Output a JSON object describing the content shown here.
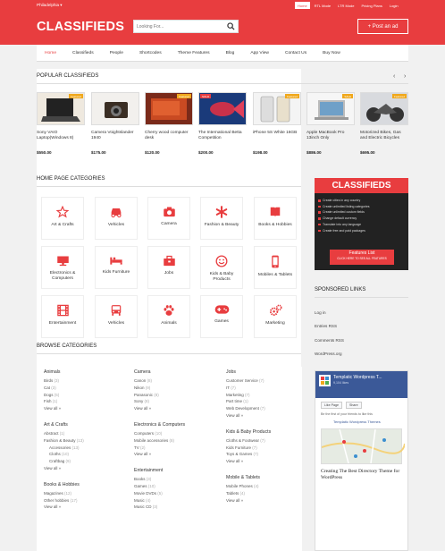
{
  "header": {
    "city": "Philadelphia",
    "top_links": [
      "Home",
      "RTL Mode",
      "LTR Mode",
      "Pricing Plans",
      "Login"
    ],
    "logo": "CLASSIFIEDS",
    "search_placeholder": "Looking For...",
    "post_ad": "+ Post an ad",
    "brand_color": "#e83d3f"
  },
  "nav": [
    "Home",
    "Classifieds",
    "People",
    "Shortcodes",
    "Theme Features",
    "Blog",
    "App View",
    "Contact Us",
    "Buy Now"
  ],
  "popular": {
    "title": "POPULAR CLASSIFIEDS",
    "items": [
      {
        "title": "Sony VAIO Laptop(Windows 8)",
        "price": "$550.00",
        "badge": "Featured"
      },
      {
        "title": "Camera Voightslander 1940",
        "price": "$175.00",
        "badge": ""
      },
      {
        "title": "Cherry wood computer desk",
        "price": "$120.00",
        "badge": "Featured"
      },
      {
        "title": "The International Betta Competition",
        "price": "$200.00",
        "badge": "SOLD"
      },
      {
        "title": "iPhone 5S White 16GB",
        "price": "$198.00",
        "badge": "Featured"
      },
      {
        "title": "Apple MacBook Pro 13inch Only",
        "price": "$886.00",
        "badge": "SALE"
      },
      {
        "title": "Motorized Bikes, Gas and Electric Bicycles",
        "price": "$695.00",
        "badge": "Featured"
      }
    ]
  },
  "home_categories": {
    "title": "HOME PAGE CATEGORIES",
    "items": [
      {
        "label": "Art & Crafts",
        "icon": "star-icon"
      },
      {
        "label": "Vehicles",
        "icon": "car-icon"
      },
      {
        "label": "Camera",
        "icon": "camera-icon"
      },
      {
        "label": "Fashion & Beauty",
        "icon": "asterisk-icon"
      },
      {
        "label": "Books & Hobbies",
        "icon": "book-icon"
      },
      {
        "label": "Electronics & Computers",
        "icon": "monitor-icon"
      },
      {
        "label": "Kids Furniture",
        "icon": "bed-icon"
      },
      {
        "label": "Jobs",
        "icon": "briefcase-icon"
      },
      {
        "label": "Kids & Baby Products",
        "icon": "smile-icon"
      },
      {
        "label": "Mobiles & Tablets",
        "icon": "mobile-icon"
      },
      {
        "label": "Entertainment",
        "icon": "film-icon"
      },
      {
        "label": "Vehicles",
        "icon": "truck-icon"
      },
      {
        "label": "Animals",
        "icon": "paw-icon"
      },
      {
        "label": "Games",
        "icon": "gamepad-icon"
      },
      {
        "label": "Marketing",
        "icon": "gears-icon"
      }
    ]
  },
  "browse": {
    "title": "BROWSE CATEGORIES",
    "columns": [
      [
        {
          "title": "Animals",
          "items": [
            [
              "Birds",
              "(3)",
              false
            ],
            [
              "Cat",
              "(3)",
              false
            ],
            [
              "Dogs",
              "(5)",
              false
            ],
            [
              "Fish",
              "(1)",
              false
            ],
            [
              "View all »",
              "",
              false
            ]
          ]
        },
        {
          "title": "Art & Crafts",
          "items": [
            [
              "Abstract",
              "(1)",
              false
            ],
            [
              "Fashion & Beauty",
              "(13)",
              false
            ],
            [
              "Accessories",
              "(13)",
              true
            ],
            [
              "Cloths",
              "(10)",
              true
            ],
            [
              "Craftbag",
              "(9)",
              true
            ],
            [
              "View all »",
              "",
              false
            ]
          ]
        },
        {
          "title": "Books & Hobbies",
          "items": [
            [
              "Magazines",
              "(12)",
              false
            ],
            [
              "Other hobbies",
              "(17)",
              false
            ],
            [
              "View all »",
              "",
              false
            ]
          ]
        }
      ],
      [
        {
          "title": "Camera",
          "items": [
            [
              "Canon",
              "(8)",
              false
            ],
            [
              "Nikon",
              "(9)",
              false
            ],
            [
              "Panasonic",
              "(8)",
              false
            ],
            [
              "Sony",
              "(8)",
              false
            ],
            [
              "View all »",
              "",
              false
            ]
          ]
        },
        {
          "title": "Electronics & Computers",
          "items": [
            [
              "Computers",
              "(10)",
              false
            ],
            [
              "Mobile accessories",
              "(8)",
              false
            ],
            [
              "TV",
              "(2)",
              false
            ],
            [
              "View all »",
              "",
              false
            ]
          ]
        },
        {
          "title": "Entertainment",
          "items": [
            [
              "Books",
              "(3)",
              false
            ],
            [
              "Games",
              "(10)",
              false
            ],
            [
              "Movie DVDs",
              "(5)",
              false
            ],
            [
              "Music",
              "(4)",
              false
            ],
            [
              "Music CD",
              "(3)",
              false
            ]
          ]
        }
      ],
      [
        {
          "title": "Jobs",
          "items": [
            [
              "Customer Service",
              "(7)",
              false
            ],
            [
              "IT",
              "(7)",
              false
            ],
            [
              "Marketing",
              "(7)",
              false
            ],
            [
              "Part time",
              "(1)",
              false
            ],
            [
              "Web Development",
              "(7)",
              false
            ],
            [
              "View all »",
              "",
              false
            ]
          ]
        },
        {
          "title": "Kids & Baby Products",
          "items": [
            [
              "Cloths & Footwear",
              "(7)",
              false
            ],
            [
              "Kids Furniture",
              "(7)",
              false
            ],
            [
              "Toys & Games",
              "(7)",
              false
            ],
            [
              "View all »",
              "",
              false
            ]
          ]
        },
        {
          "title": "Mobile & Tablets",
          "items": [
            [
              "Mobile Phones",
              "(4)",
              false
            ],
            [
              "Tablets",
              "(4)",
              false
            ],
            [
              "View all »",
              "",
              false
            ]
          ]
        }
      ]
    ]
  },
  "sidebar": {
    "ad": {
      "title": "CLASSIFIEDS",
      "bullets": [
        "Create cities in any country",
        "Create unlimited listing categories",
        "Create unlimited custom fields",
        "Change default currency",
        "Translate into any language",
        "Create free and paid packages"
      ],
      "button": "Features List",
      "button_sub": "CLICK HERE TO SEE ALL FEATURES"
    },
    "sponsored_title": "SPONSORED LINKS",
    "links": [
      "Log in",
      "Entries RSS",
      "Comments RSS",
      "WordPress.org"
    ],
    "fb": {
      "page": "Templatic Wordpress T...",
      "likes": "9,104 likes",
      "like_btn": "Like Page",
      "share_btn": "Share",
      "friends": "Be the first of your friends to like this",
      "post_author": "Templatic Wordpress Themes",
      "caption": "Creating The Best Directory Theme for WordPress"
    }
  }
}
